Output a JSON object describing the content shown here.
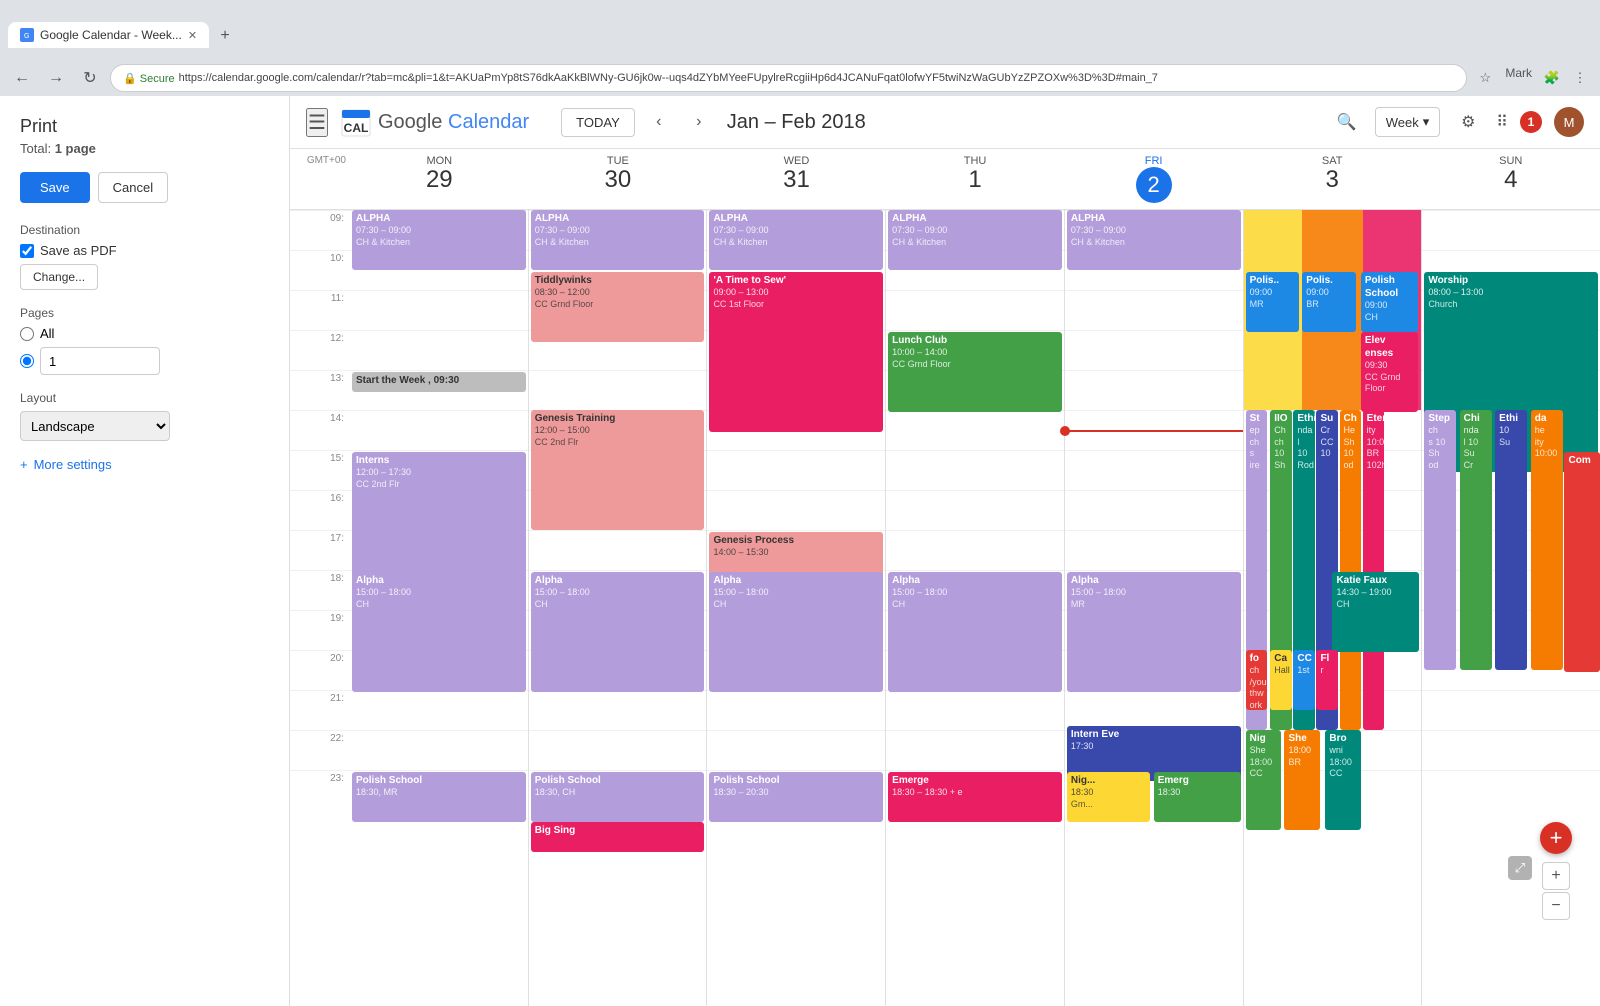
{
  "browser": {
    "tab_title": "Google Calendar - Week...",
    "url": "https://calendar.google.com/calendar/r?tab=mc&pli=1&t=AKUaPmYp8tS76dkAaKkBlWNy-GU6jk0w--uqs4dZYbMYeeFUpylreRcgiiHp6d4JCANuFqat0lofwYF5twiNzWaGUbYzZPZOXw%3D%3D#main_7",
    "user": "Mark"
  },
  "print_dialog": {
    "title": "Print",
    "total": "Total:",
    "total_value": "1 page",
    "save_label": "Save",
    "cancel_label": "Cancel",
    "destination_label": "Destination",
    "save_as_pdf": "Save as PDF",
    "change_btn": "Change...",
    "pages_label": "Pages",
    "all_label": "All",
    "page_num_value": "1",
    "layout_label": "Layout",
    "layout_value": "Landscape",
    "more_settings": "More settings"
  },
  "calendar": {
    "today_label": "TODAY",
    "month_label": "Jan – Feb 2018",
    "view_label": "Week",
    "gmt_label": "GMT+00",
    "days": [
      {
        "name": "Mon",
        "num": "29",
        "is_today": false
      },
      {
        "name": "Tue",
        "num": "30",
        "is_today": false
      },
      {
        "name": "Wed",
        "num": "31",
        "is_today": false
      },
      {
        "name": "Thu",
        "num": "1",
        "is_today": false
      },
      {
        "name": "Fri",
        "num": "2",
        "is_today": true
      },
      {
        "name": "Sat",
        "num": "3",
        "is_today": false
      },
      {
        "name": "Sun",
        "num": "4",
        "is_today": false
      }
    ],
    "times": [
      "09:",
      "10:",
      "11:",
      "12:",
      "13:",
      "14:",
      "15:",
      "16:",
      "17:",
      "18:",
      "19:",
      "20:",
      "21:",
      "22:",
      "23:"
    ],
    "notification_count": "1"
  }
}
